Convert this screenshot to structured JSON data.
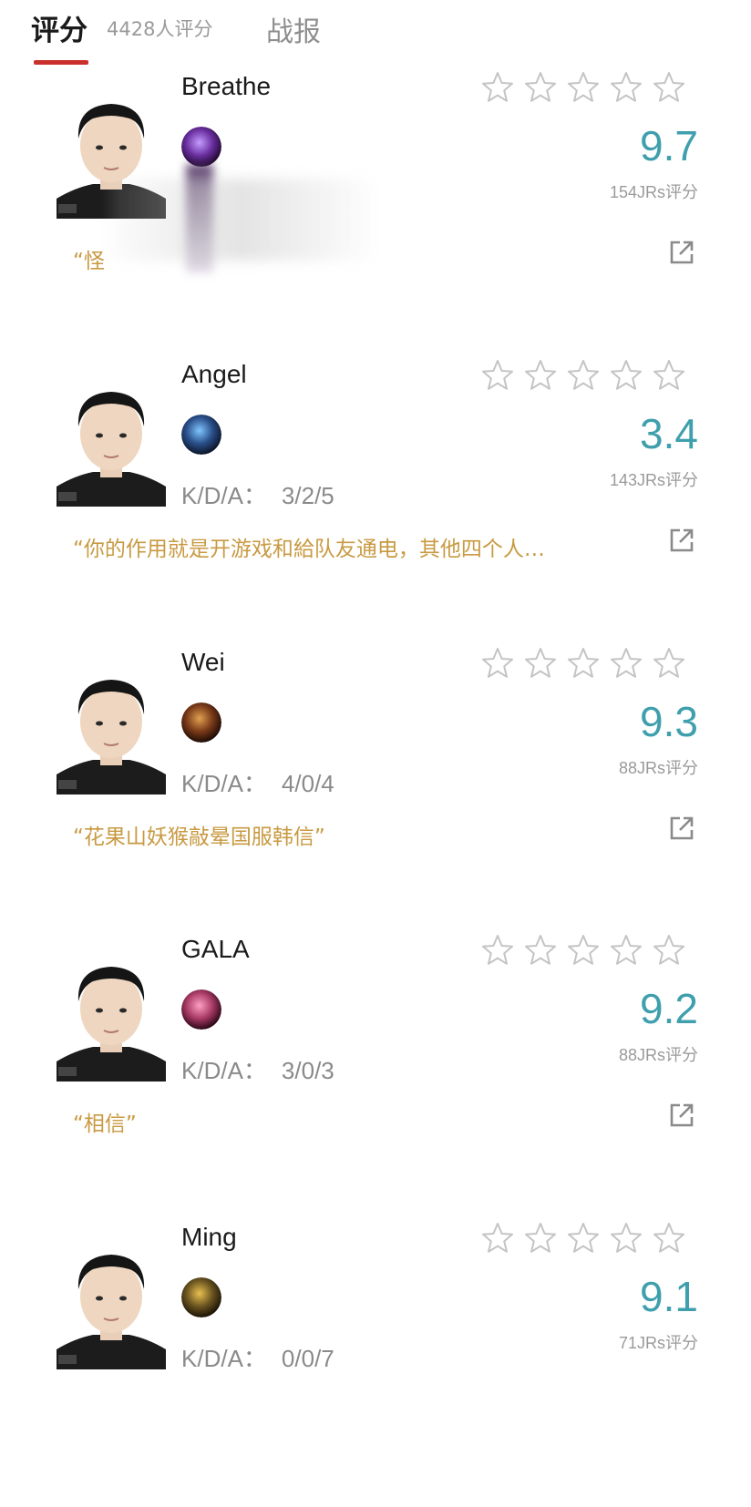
{
  "tabs": {
    "active_label": "评分",
    "rating_count": "4428人评分",
    "other_label": "战报"
  },
  "colors": {
    "accent_red": "#c9302c",
    "score_teal": "#3f9fad",
    "comment_gold": "#c89a42",
    "muted_gray": "#9a9a9a"
  },
  "players": [
    {
      "name": "Breathe",
      "kda_label": "",
      "kda": "",
      "score": "9.7",
      "count": "154JRs评分",
      "comment": "“怪",
      "hero_icon": "hero-purple-icon"
    },
    {
      "name": "Angel",
      "kda_label": "K/D/A：",
      "kda": "3/2/5",
      "score": "3.4",
      "count": "143JRs评分",
      "comment": "“你的作用就是开游戏和給队友通电，其他四个人…",
      "hero_icon": "hero-blue-icon"
    },
    {
      "name": "Wei",
      "kda_label": "K/D/A：",
      "kda": "4/0/4",
      "score": "9.3",
      "count": "88JRs评分",
      "comment": "“花果山妖猴敲晕国服韩信”",
      "hero_icon": "hero-monkey-icon"
    },
    {
      "name": "GALA",
      "kda_label": "K/D/A：",
      "kda": "3/0/3",
      "score": "9.2",
      "count": "88JRs评分",
      "comment": "“相信”",
      "hero_icon": "hero-pink-icon"
    },
    {
      "name": "Ming",
      "kda_label": "K/D/A：",
      "kda": "0/0/7",
      "score": "9.1",
      "count": "71JRs评分",
      "comment": "",
      "hero_icon": "hero-gold-icon"
    }
  ]
}
